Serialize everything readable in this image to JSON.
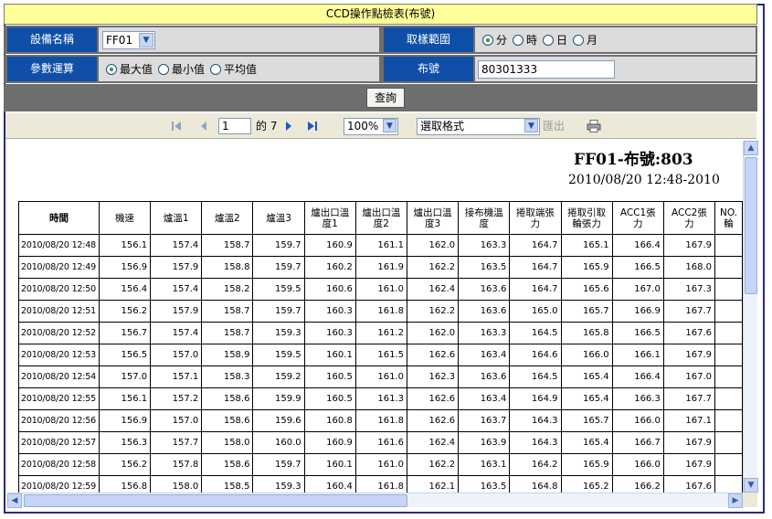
{
  "title": "CCD操作點檢表(布號)",
  "params": {
    "equipment_label": "設備名稱",
    "equipment_value": "FF01",
    "range_label": "取樣範圍",
    "range_options": [
      "分",
      "時",
      "日",
      "月"
    ],
    "range_selected": "分",
    "calc_label": "參數運算",
    "calc_options": [
      "最大值",
      "最小值",
      "平均值"
    ],
    "calc_selected": "最大值",
    "cloth_label": "布號",
    "cloth_value": "80301333",
    "query_label": "查詢"
  },
  "toolbar": {
    "page_value": "1",
    "page_of": "的 7",
    "zoom": "100%",
    "format_placeholder": "選取格式",
    "export_label": "匯出"
  },
  "report": {
    "title": "FF01-布號:803",
    "date": "2010/08/20 12:48-2010"
  },
  "table": {
    "headers": [
      "時間",
      "機速",
      "爐溫1",
      "爐溫2",
      "爐溫3",
      "爐出口溫度1",
      "爐出口溫度2",
      "爐出口溫度3",
      "接布機溫度",
      "捲取端張力",
      "捲取引取輪張力",
      "ACC1張力",
      "ACC2張力",
      "NO.輪"
    ],
    "rows": [
      [
        "2010/08/20 12:48",
        "156.1",
        "157.4",
        "158.7",
        "159.7",
        "160.9",
        "161.1",
        "162.0",
        "163.3",
        "164.7",
        "165.1",
        "166.4",
        "167.9",
        ""
      ],
      [
        "2010/08/20 12:49",
        "156.9",
        "157.9",
        "158.8",
        "159.7",
        "160.2",
        "161.9",
        "162.2",
        "163.5",
        "164.7",
        "165.9",
        "166.5",
        "168.0",
        ""
      ],
      [
        "2010/08/20 12:50",
        "156.4",
        "157.4",
        "158.2",
        "159.5",
        "160.6",
        "161.0",
        "162.4",
        "163.6",
        "164.7",
        "165.6",
        "167.0",
        "167.3",
        ""
      ],
      [
        "2010/08/20 12:51",
        "156.2",
        "157.9",
        "158.7",
        "159.7",
        "160.3",
        "161.8",
        "162.2",
        "163.6",
        "165.0",
        "165.7",
        "166.9",
        "167.7",
        ""
      ],
      [
        "2010/08/20 12:52",
        "156.7",
        "157.4",
        "158.7",
        "159.3",
        "160.3",
        "161.2",
        "162.0",
        "163.3",
        "164.5",
        "165.8",
        "166.5",
        "167.6",
        ""
      ],
      [
        "2010/08/20 12:53",
        "156.5",
        "157.0",
        "158.9",
        "159.5",
        "160.1",
        "161.5",
        "162.6",
        "163.4",
        "164.6",
        "166.0",
        "166.1",
        "167.9",
        ""
      ],
      [
        "2010/08/20 12:54",
        "157.0",
        "157.1",
        "158.3",
        "159.2",
        "160.5",
        "161.0",
        "162.3",
        "163.6",
        "164.5",
        "165.4",
        "166.4",
        "167.0",
        ""
      ],
      [
        "2010/08/20 12:55",
        "156.1",
        "157.2",
        "158.6",
        "159.9",
        "160.5",
        "161.3",
        "162.6",
        "163.4",
        "164.9",
        "165.4",
        "166.3",
        "167.7",
        ""
      ],
      [
        "2010/08/20 12:56",
        "156.9",
        "157.0",
        "158.6",
        "159.6",
        "160.8",
        "161.8",
        "162.6",
        "163.7",
        "164.3",
        "165.7",
        "166.0",
        "167.1",
        ""
      ],
      [
        "2010/08/20 12:57",
        "156.3",
        "157.7",
        "158.0",
        "160.0",
        "160.9",
        "161.6",
        "162.4",
        "163.9",
        "164.3",
        "165.4",
        "166.7",
        "167.9",
        ""
      ],
      [
        "2010/08/20 12:58",
        "156.2",
        "157.8",
        "158.6",
        "159.7",
        "160.1",
        "161.0",
        "162.2",
        "163.1",
        "164.2",
        "165.9",
        "166.0",
        "167.9",
        ""
      ],
      [
        "2010/08/20 12:59",
        "156.8",
        "158.0",
        "158.5",
        "159.3",
        "160.4",
        "161.8",
        "162.1",
        "163.5",
        "164.8",
        "165.2",
        "166.2",
        "167.6",
        ""
      ]
    ]
  },
  "icons": {
    "first_page": "first-page-icon",
    "prev_page": "prev-page-icon",
    "next_page": "next-page-icon",
    "last_page": "last-page-icon",
    "print": "print-icon"
  },
  "colors": {
    "label_bg": "#0f4fa8",
    "title_bg": "#ffff99",
    "toolbar_bg": "#ece9d8"
  }
}
